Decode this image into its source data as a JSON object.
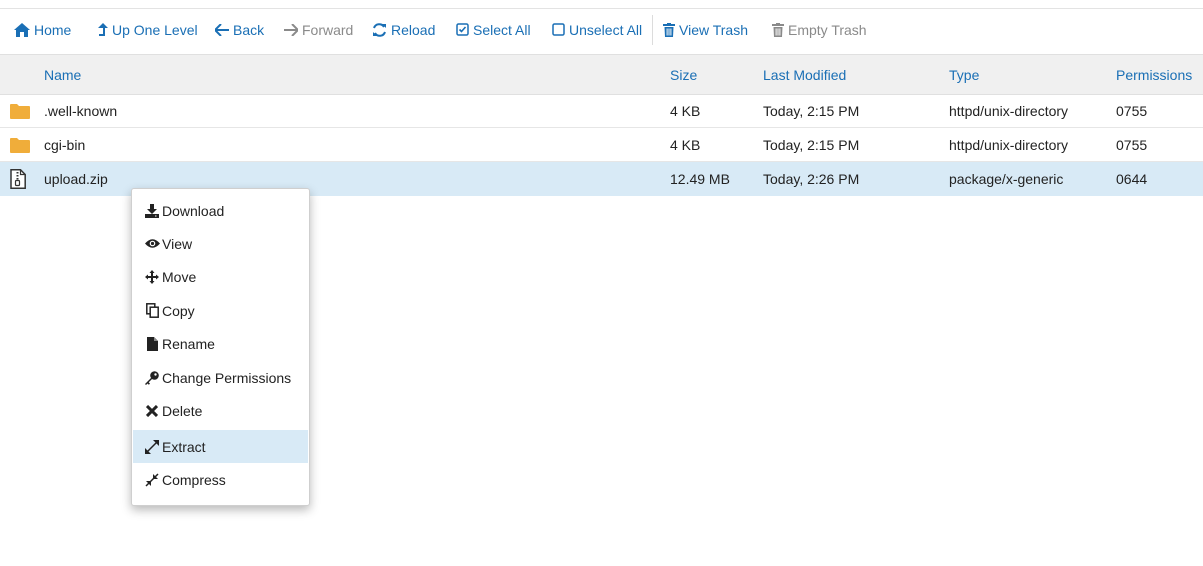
{
  "toolbar": {
    "home": "Home",
    "up_one_level": "Up One Level",
    "back": "Back",
    "forward": "Forward",
    "reload": "Reload",
    "select_all": "Select All",
    "unselect_all": "Unselect All",
    "view_trash": "View Trash",
    "empty_trash": "Empty Trash"
  },
  "table": {
    "headers": {
      "name": "Name",
      "size": "Size",
      "last_modified": "Last Modified",
      "type": "Type",
      "permissions": "Permissions"
    },
    "rows": [
      {
        "icon": "folder-icon",
        "name": ".well-known",
        "size": "4 KB",
        "modified": "Today, 2:15 PM",
        "type": "httpd/unix-directory",
        "perms": "0755"
      },
      {
        "icon": "folder-icon",
        "name": "cgi-bin",
        "size": "4 KB",
        "modified": "Today, 2:15 PM",
        "type": "httpd/unix-directory",
        "perms": "0755"
      },
      {
        "icon": "archive-file-icon",
        "name": "upload.zip",
        "size": "12.49 MB",
        "modified": "Today, 2:26 PM",
        "type": "package/x-generic",
        "perms": "0644",
        "selected": true
      }
    ]
  },
  "context_menu": {
    "items": [
      {
        "label": "Download",
        "icon": "download-icon"
      },
      {
        "label": "View",
        "icon": "eye-icon"
      },
      {
        "label": "Move",
        "icon": "move-arrows-icon"
      },
      {
        "label": "Copy",
        "icon": "copy-icon"
      },
      {
        "label": "Rename",
        "icon": "file-icon"
      },
      {
        "label": "Change Permissions",
        "icon": "key-icon"
      },
      {
        "label": "Delete",
        "icon": "close-icon"
      },
      {
        "label": "Extract",
        "icon": "expand-icon",
        "highlighted": true
      },
      {
        "label": "Compress",
        "icon": "compress-icon"
      }
    ]
  },
  "colors": {
    "link": "#1a6fb5",
    "disabled": "#8a8a8a",
    "selected_row": "#d8eaf6",
    "header_bg": "#f0f0f0",
    "folder": "#f0ad3a"
  }
}
